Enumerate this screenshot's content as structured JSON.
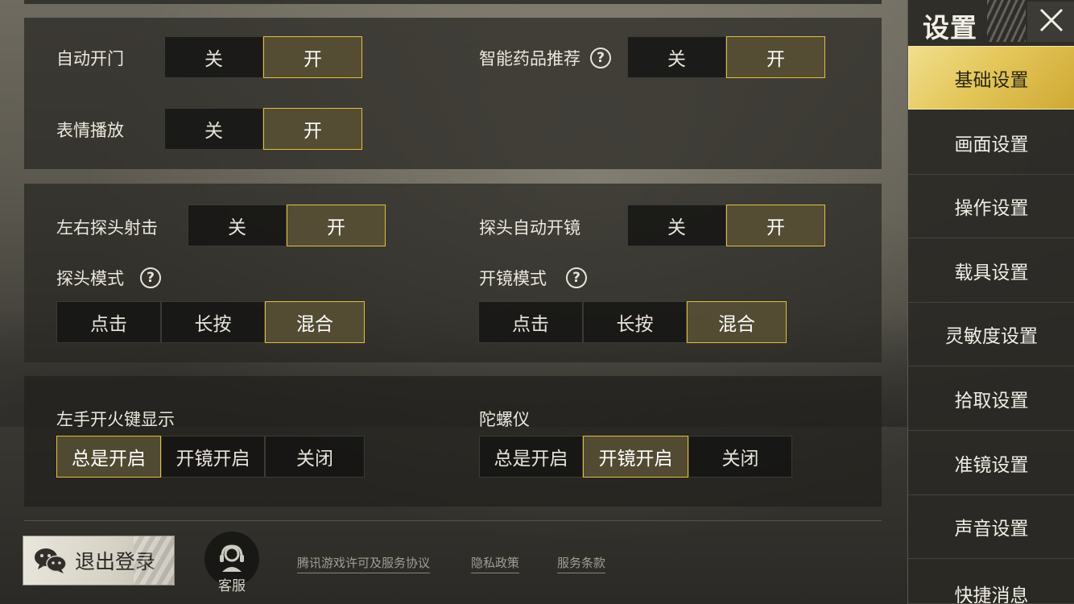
{
  "colors": {
    "accent": "#e2bf3b",
    "panel_bg": "#28272380",
    "active_tab": "#e4c65a"
  },
  "settings": {
    "auto_door": {
      "label": "自动开门",
      "options": [
        "关",
        "开"
      ],
      "selected": 1
    },
    "smart_meds": {
      "label": "智能药品推荐",
      "options": [
        "关",
        "开"
      ],
      "selected": 1,
      "help": "?"
    },
    "emote": {
      "label": "表情播放",
      "options": [
        "关",
        "开"
      ],
      "selected": 1
    },
    "peek_fire": {
      "label": "左右探头射击",
      "options": [
        "关",
        "开"
      ],
      "selected": 1
    },
    "peek_scope": {
      "label": "探头自动开镜",
      "options": [
        "关",
        "开"
      ],
      "selected": 1
    },
    "peek_mode": {
      "label": "探头模式",
      "options": [
        "点击",
        "长按",
        "混合"
      ],
      "selected": 2,
      "help": "?"
    },
    "scope_mode": {
      "label": "开镜模式",
      "options": [
        "点击",
        "长按",
        "混合"
      ],
      "selected": 2,
      "help": "?"
    },
    "left_fire": {
      "label": "左手开火键显示",
      "options": [
        "总是开启",
        "开镜开启",
        "关闭"
      ],
      "selected": 0
    },
    "gyro": {
      "label": "陀螺仪",
      "options": [
        "总是开启",
        "开镜开启",
        "关闭"
      ],
      "selected": 1
    }
  },
  "footer": {
    "logout_label": "退出登录",
    "logout_icon": "wechat-icon",
    "service_label": "客服",
    "service_icon": "headset-icon",
    "links": [
      "腾讯游戏许可及服务协议",
      "隐私政策",
      "服务条款"
    ]
  },
  "sidebar": {
    "title": "设置",
    "close_icon": "close-icon",
    "items": [
      {
        "label": "基础设置",
        "active": true
      },
      {
        "label": "画面设置",
        "active": false
      },
      {
        "label": "操作设置",
        "active": false
      },
      {
        "label": "载具设置",
        "active": false
      },
      {
        "label": "灵敏度设置",
        "active": false
      },
      {
        "label": "拾取设置",
        "active": false
      },
      {
        "label": "准镜设置",
        "active": false
      },
      {
        "label": "声音设置",
        "active": false
      },
      {
        "label": "快捷消息",
        "active": false
      }
    ]
  }
}
